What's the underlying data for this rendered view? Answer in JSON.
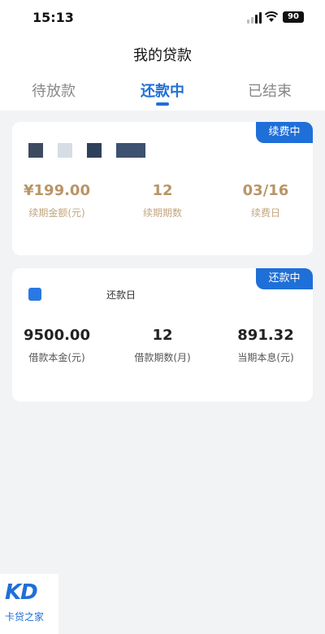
{
  "status_bar": {
    "time": "15:13",
    "battery": "90"
  },
  "header": {
    "title": "我的贷款"
  },
  "tabs": [
    {
      "label": "待放款"
    },
    {
      "label": "还款中"
    },
    {
      "label": "已结束"
    }
  ],
  "renewal_card": {
    "badge": "续费中",
    "amount": {
      "value": "¥199.00",
      "label": "续期金额(元)"
    },
    "periods": {
      "value": "12",
      "label": "续期期数"
    },
    "renewal_day": {
      "value": "03/16",
      "label": "续费日"
    }
  },
  "loan_card": {
    "badge": "还款中",
    "due_date_label": "还款日",
    "principal": {
      "value": "9500.00",
      "label": "借款本金(元)"
    },
    "periods": {
      "value": "12",
      "label": "借款期数(月)"
    },
    "current": {
      "value": "891.32",
      "label": "当期本息(元)"
    }
  },
  "logo": {
    "mark": "KD",
    "name": "卡贷之家"
  },
  "colors": {
    "accent": "#1f6fd8",
    "gold": "#b89567"
  }
}
